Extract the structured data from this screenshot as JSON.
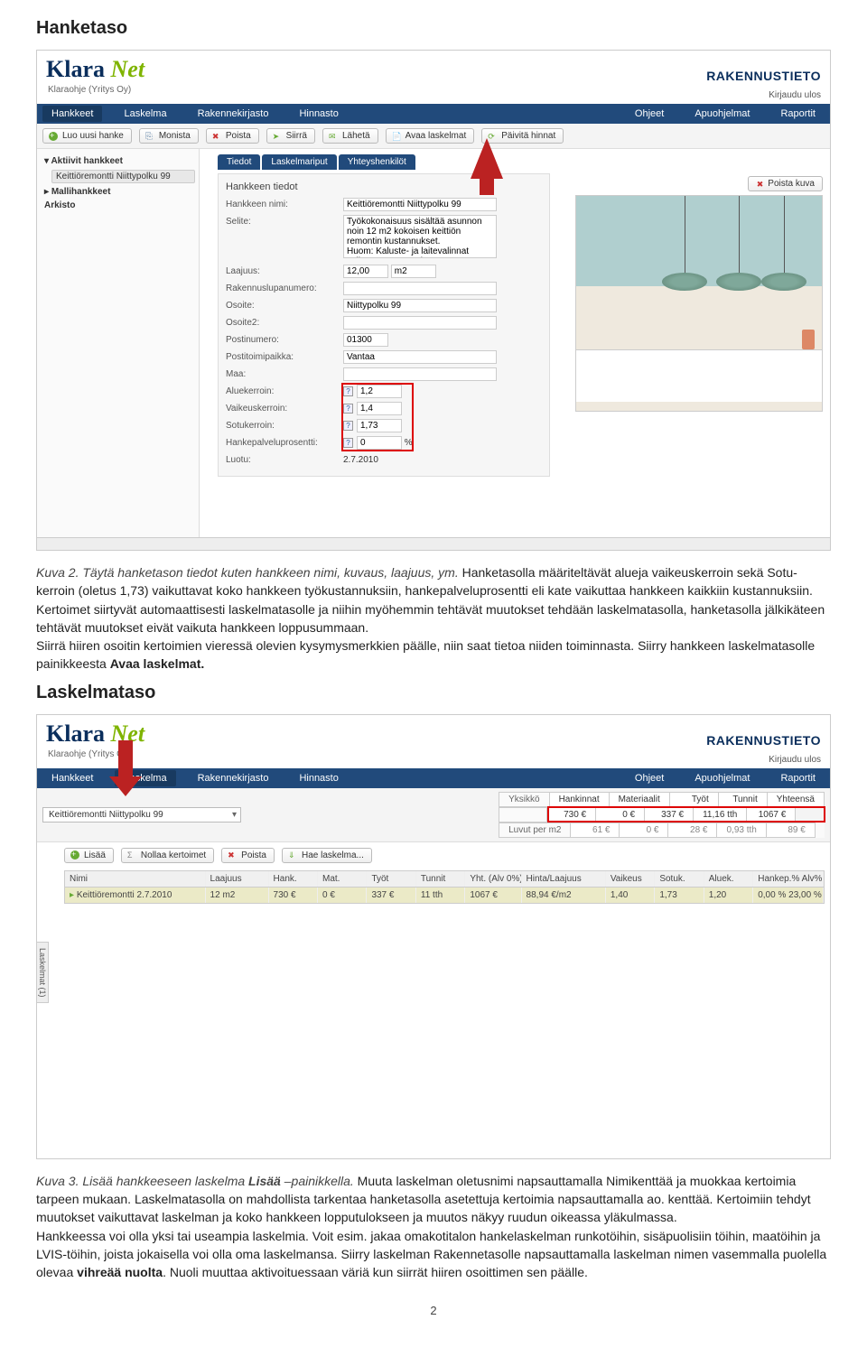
{
  "heading1": "Hanketaso",
  "ss1": {
    "logo": {
      "klara": "Klara",
      "net": "Net",
      "sub": "Klaraohje (Yritys Oy)"
    },
    "brand": "RAKENNUSTIETO",
    "logout": "Kirjaudu ulos",
    "bluetabs": [
      "Hankkeet",
      "Laskelma",
      "Rakennekirjasto",
      "Hinnasto"
    ],
    "bluetabs_right": [
      "Ohjeet",
      "Apuohjelmat",
      "Raportit"
    ],
    "toolbar": [
      "Luo uusi hanke",
      "Monista",
      "Poista",
      "Siirrä",
      "Lähetä",
      "Avaa laskelmat",
      "Päivitä hinnat"
    ],
    "tree": {
      "active": "Aktiivit hankkeet",
      "item": "Keittiöremontti Niittypolku 99",
      "model": "Mallihankkeet",
      "archive": "Arkisto"
    },
    "midtabs": [
      "Tiedot",
      "Laskelmariput",
      "Yhteyshenkilöt"
    ],
    "form": {
      "panel_title": "Hankkeen tiedot",
      "poista_kuva": "Poista kuva",
      "labels": [
        "Hankkeen nimi:",
        "Selite:",
        "Laajuus:",
        "Rakennuslupanumero:",
        "Osoite:",
        "Osoite2:",
        "Postinumero:",
        "Postitoimipaikka:",
        "Maa:",
        "Aluekerroin:",
        "Vaikeuskerroin:",
        "Sotukerroin:",
        "Hankepalveluprosentti:",
        "Luotu:"
      ],
      "values": {
        "name": "Keittiöremontti Niittypolku 99",
        "desc": "Työkokonaisuus sisältää asunnon noin 12 m2 kokoisen keittiön remontin kustannukset.\nHuom: Kaluste- ja laitevalinnat vaikuttavat remontin kokonaiskustannuksiin",
        "laajuus": "12,00",
        "laajuus_unit": "m2",
        "osoite": "Niittypolku 99",
        "postnum": "01300",
        "city": "Vantaa",
        "alue": "1,2",
        "vaik": "1,4",
        "sotu": "1,73",
        "hpp": "0",
        "hpp_unit": "%",
        "luotu": "2.7.2010"
      }
    }
  },
  "caption1": {
    "kuva": "Kuva 2. Täytä hanketason tiedot kuten hankkeen nimi, kuvaus, laajuus, ym.",
    "body": " Hanketasolla määriteltävät alueja vaikeuskerroin sekä Sotu-kerroin (oletus 1,73) vaikuttavat koko hankkeen työkustannuksiin, hankepalveluprosentti eli kate vaikuttaa hankkeen kaikkiin kustannuksiin. Kertoimet siirtyvät automaattisesti laskelmatasolle ja niihin myöhemmin tehtävät muutokset tehdään laskelmatasolla, hanketasolla jälkikäteen tehtävät muutokset eivät vaikuta hankkeen loppusummaan.",
    "body2": "Siirrä hiiren osoitin kertoimien vieressä olevien kysymysmerkkien päälle, niin saat tietoa niiden toiminnasta. Siirry hankkeen laskelmatasolle painikkeesta ",
    "bold": "Avaa laskelmat."
  },
  "heading2": "Laskelmataso",
  "ss2": {
    "dd": "Keittiöremontti Niittypolku 99",
    "sum_labels": [
      "Yksikkö",
      "Hankinnat",
      "Materiaalit",
      "Työt",
      "Tunnit",
      "Yhteensä"
    ],
    "sum_vals": [
      "",
      "730 €",
      "0 €",
      "337 €",
      "11,16 tth",
      "1067 €"
    ],
    "perm2_label": "Luvut per m2",
    "perm2_vals": [
      "61 €",
      "0 €",
      "28 €",
      "0,93 tth",
      "89 €"
    ],
    "tools": [
      "Lisää",
      "Nollaa kertoimet",
      "Poista",
      "Hae laskelma..."
    ],
    "verttab": "Laskelmat (1)",
    "grid_hdr": [
      "Nimi",
      "Laajuus",
      "Hank.",
      "Mat.",
      "Työt",
      "Tunnit",
      "Yht. (Alv 0%)",
      "Hinta/Laajuus",
      "Vaikeus",
      "Sotuk.",
      "Aluek.",
      "Hankep.% Alv%"
    ],
    "grid_row": [
      "Keittiöremontti 2.7.2010",
      "12 m2",
      "730 €",
      "0 €",
      "337 €",
      "11 tth",
      "1067 €",
      "88,94 €/m2",
      "1,40",
      "1,73",
      "1,20",
      "0,00 %  23,00 %"
    ]
  },
  "caption2": {
    "kuva": "Kuva 3. Lisää hankkeeseen laskelma ",
    "bold1": "Lisää",
    "kuva_tail": " –painikkella.",
    "body": " Muuta laskelman oletusnimi napsauttamalla Nimikenttää ja muokkaa kertoimia tarpeen mukaan. Laskelmatasolla on mahdollista tarkentaa hanketasolla asetettuja kertoimia napsauttamalla ao. kenttää. Kertoimiin tehdyt muutokset vaikuttavat laskelman ja koko hankkeen lopputulokseen ja muutos näkyy ruudun oikeassa yläkulmassa.",
    "body2": "Hankkeessa voi olla yksi tai useampia laskelmia. Voit esim. jakaa omakotitalon hankelaskelman runkotöihin, sisäpuolisiin töihin, maatöihin ja LVIS-töihin, joista jokaisella voi olla oma laskelmansa.  Siirry laskelman Rakennetasolle napsauttamalla laskelman nimen vasemmalla puolella olevaa ",
    "bold2": "vihreää nuolta",
    "tail": ". Nuoli muuttaa aktivoituessaan väriä kun siirrät hiiren osoittimen sen päälle."
  },
  "pagenum": "2"
}
